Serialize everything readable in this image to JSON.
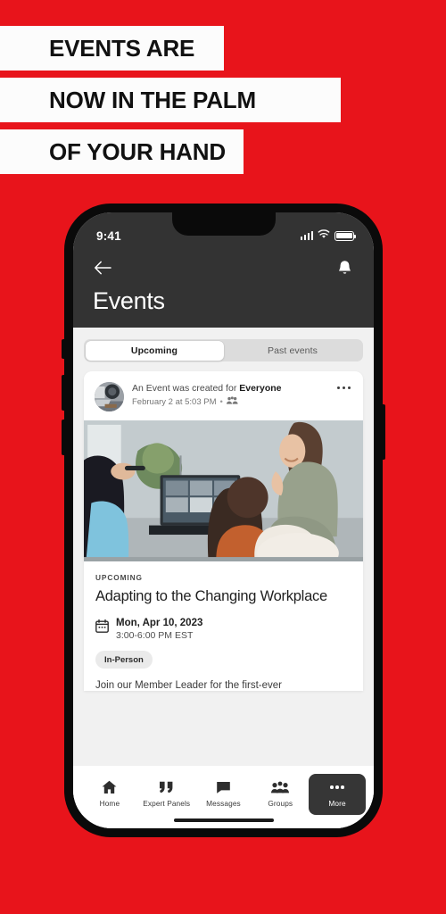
{
  "theme": {
    "brand_red": "#E8141B",
    "header_dark": "#333333",
    "page_bg": "#F1F1F1",
    "card_white": "#FFFFFF",
    "pill_gray": "#EAEAEA",
    "nav_active_dark": "#363636"
  },
  "promo": {
    "lines": [
      "EVENTS ARE",
      "NOW IN THE PALM",
      "OF YOUR HAND"
    ]
  },
  "phone": {
    "status_bar": {
      "time": "9:41",
      "icons": [
        "signal-icon",
        "wifi-icon",
        "battery-icon"
      ]
    },
    "header": {
      "back_icon": "arrow-left-icon",
      "notification_icon": "bell-icon",
      "title": "Events"
    },
    "tabs": [
      {
        "label": "Upcoming",
        "active": true
      },
      {
        "label": "Past events",
        "active": false
      }
    ],
    "post": {
      "avatar_icon": "avatar-photo",
      "created_prefix": "An Event was created for",
      "audience": "Everyone",
      "timestamp": "February 2 at 5:03 PM",
      "separator": "•",
      "audience_icon": "people-icon",
      "menu_icon": "kebab-menu-icon"
    },
    "event": {
      "status_label": "UPCOMING",
      "title": "Adapting to the Changing Workplace",
      "calendar_icon": "calendar-icon",
      "date": "Mon, Apr 10, 2023",
      "time": "3:00-6:00 PM EST",
      "format_badge": "In-Person",
      "description": "Join our Member Leader for the first-ever"
    },
    "bottom_nav": [
      {
        "label": "Home",
        "icon": "home-icon",
        "active": false
      },
      {
        "label": "Expert Panels",
        "icon": "quote-icon",
        "active": false
      },
      {
        "label": "Messages",
        "icon": "chat-bubble-icon",
        "active": false
      },
      {
        "label": "Groups",
        "icon": "people-group-icon",
        "active": false
      },
      {
        "label": "More",
        "icon": "ellipsis-icon",
        "active": true
      }
    ]
  }
}
